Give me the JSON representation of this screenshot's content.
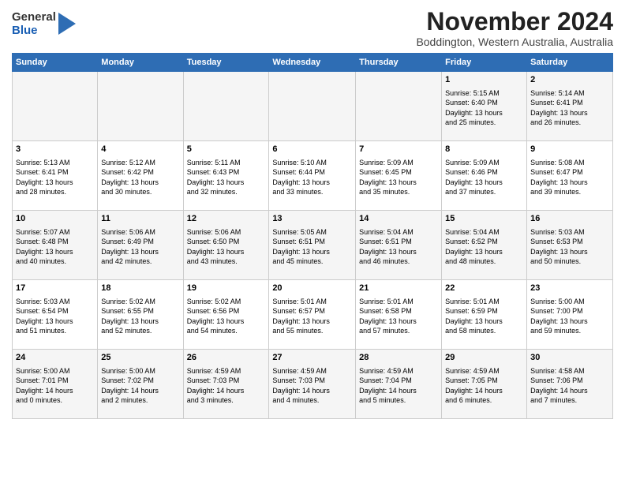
{
  "header": {
    "logo": {
      "general": "General",
      "blue": "Blue"
    },
    "title": "November 2024",
    "subtitle": "Boddington, Western Australia, Australia"
  },
  "columns": [
    "Sunday",
    "Monday",
    "Tuesday",
    "Wednesday",
    "Thursday",
    "Friday",
    "Saturday"
  ],
  "weeks": [
    [
      {
        "day": "",
        "content": ""
      },
      {
        "day": "",
        "content": ""
      },
      {
        "day": "",
        "content": ""
      },
      {
        "day": "",
        "content": ""
      },
      {
        "day": "",
        "content": ""
      },
      {
        "day": "1",
        "content": "Sunrise: 5:15 AM\nSunset: 6:40 PM\nDaylight: 13 hours\nand 25 minutes."
      },
      {
        "day": "2",
        "content": "Sunrise: 5:14 AM\nSunset: 6:41 PM\nDaylight: 13 hours\nand 26 minutes."
      }
    ],
    [
      {
        "day": "3",
        "content": "Sunrise: 5:13 AM\nSunset: 6:41 PM\nDaylight: 13 hours\nand 28 minutes."
      },
      {
        "day": "4",
        "content": "Sunrise: 5:12 AM\nSunset: 6:42 PM\nDaylight: 13 hours\nand 30 minutes."
      },
      {
        "day": "5",
        "content": "Sunrise: 5:11 AM\nSunset: 6:43 PM\nDaylight: 13 hours\nand 32 minutes."
      },
      {
        "day": "6",
        "content": "Sunrise: 5:10 AM\nSunset: 6:44 PM\nDaylight: 13 hours\nand 33 minutes."
      },
      {
        "day": "7",
        "content": "Sunrise: 5:09 AM\nSunset: 6:45 PM\nDaylight: 13 hours\nand 35 minutes."
      },
      {
        "day": "8",
        "content": "Sunrise: 5:09 AM\nSunset: 6:46 PM\nDaylight: 13 hours\nand 37 minutes."
      },
      {
        "day": "9",
        "content": "Sunrise: 5:08 AM\nSunset: 6:47 PM\nDaylight: 13 hours\nand 39 minutes."
      }
    ],
    [
      {
        "day": "10",
        "content": "Sunrise: 5:07 AM\nSunset: 6:48 PM\nDaylight: 13 hours\nand 40 minutes."
      },
      {
        "day": "11",
        "content": "Sunrise: 5:06 AM\nSunset: 6:49 PM\nDaylight: 13 hours\nand 42 minutes."
      },
      {
        "day": "12",
        "content": "Sunrise: 5:06 AM\nSunset: 6:50 PM\nDaylight: 13 hours\nand 43 minutes."
      },
      {
        "day": "13",
        "content": "Sunrise: 5:05 AM\nSunset: 6:51 PM\nDaylight: 13 hours\nand 45 minutes."
      },
      {
        "day": "14",
        "content": "Sunrise: 5:04 AM\nSunset: 6:51 PM\nDaylight: 13 hours\nand 46 minutes."
      },
      {
        "day": "15",
        "content": "Sunrise: 5:04 AM\nSunset: 6:52 PM\nDaylight: 13 hours\nand 48 minutes."
      },
      {
        "day": "16",
        "content": "Sunrise: 5:03 AM\nSunset: 6:53 PM\nDaylight: 13 hours\nand 50 minutes."
      }
    ],
    [
      {
        "day": "17",
        "content": "Sunrise: 5:03 AM\nSunset: 6:54 PM\nDaylight: 13 hours\nand 51 minutes."
      },
      {
        "day": "18",
        "content": "Sunrise: 5:02 AM\nSunset: 6:55 PM\nDaylight: 13 hours\nand 52 minutes."
      },
      {
        "day": "19",
        "content": "Sunrise: 5:02 AM\nSunset: 6:56 PM\nDaylight: 13 hours\nand 54 minutes."
      },
      {
        "day": "20",
        "content": "Sunrise: 5:01 AM\nSunset: 6:57 PM\nDaylight: 13 hours\nand 55 minutes."
      },
      {
        "day": "21",
        "content": "Sunrise: 5:01 AM\nSunset: 6:58 PM\nDaylight: 13 hours\nand 57 minutes."
      },
      {
        "day": "22",
        "content": "Sunrise: 5:01 AM\nSunset: 6:59 PM\nDaylight: 13 hours\nand 58 minutes."
      },
      {
        "day": "23",
        "content": "Sunrise: 5:00 AM\nSunset: 7:00 PM\nDaylight: 13 hours\nand 59 minutes."
      }
    ],
    [
      {
        "day": "24",
        "content": "Sunrise: 5:00 AM\nSunset: 7:01 PM\nDaylight: 14 hours\nand 0 minutes."
      },
      {
        "day": "25",
        "content": "Sunrise: 5:00 AM\nSunset: 7:02 PM\nDaylight: 14 hours\nand 2 minutes."
      },
      {
        "day": "26",
        "content": "Sunrise: 4:59 AM\nSunset: 7:03 PM\nDaylight: 14 hours\nand 3 minutes."
      },
      {
        "day": "27",
        "content": "Sunrise: 4:59 AM\nSunset: 7:03 PM\nDaylight: 14 hours\nand 4 minutes."
      },
      {
        "day": "28",
        "content": "Sunrise: 4:59 AM\nSunset: 7:04 PM\nDaylight: 14 hours\nand 5 minutes."
      },
      {
        "day": "29",
        "content": "Sunrise: 4:59 AM\nSunset: 7:05 PM\nDaylight: 14 hours\nand 6 minutes."
      },
      {
        "day": "30",
        "content": "Sunrise: 4:58 AM\nSunset: 7:06 PM\nDaylight: 14 hours\nand 7 minutes."
      }
    ]
  ]
}
